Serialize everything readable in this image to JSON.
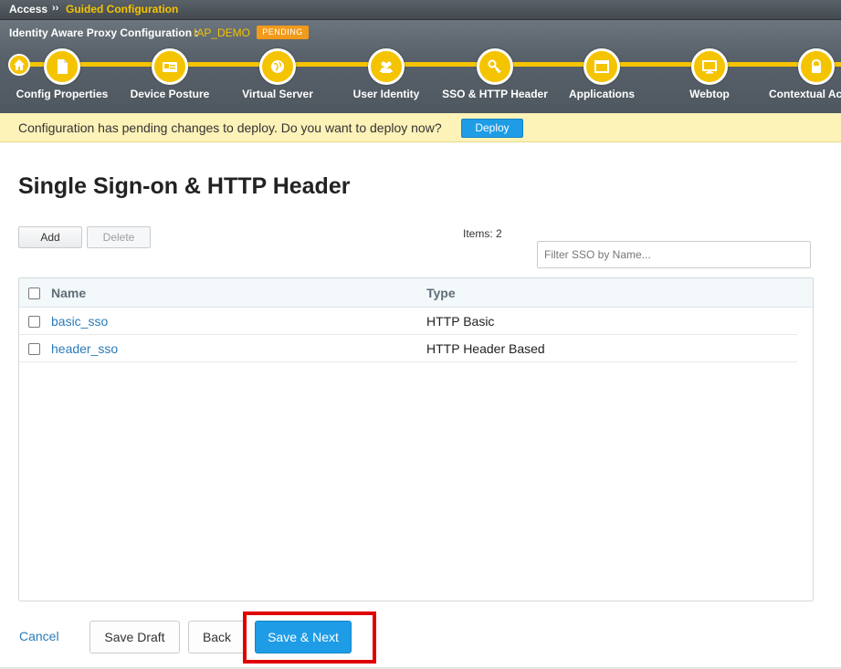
{
  "breadcrumb": {
    "root": "Access",
    "separator": "››",
    "current": "Guided Configuration"
  },
  "header": {
    "title": "Identity Aware Proxy Configuration :",
    "config_name": "IAP_DEMO",
    "status_badge": "PENDING"
  },
  "steps": [
    {
      "label": "Config Properties",
      "icon": "document-icon"
    },
    {
      "label": "Device Posture",
      "icon": "id-card-icon"
    },
    {
      "label": "Virtual Server",
      "icon": "globe-icon"
    },
    {
      "label": "User Identity",
      "icon": "users-icon"
    },
    {
      "label": "SSO & HTTP Header",
      "icon": "key-icon",
      "active": true
    },
    {
      "label": "Applications",
      "icon": "window-icon"
    },
    {
      "label": "Webtop",
      "icon": "monitor-icon"
    },
    {
      "label": "Contextual Ac",
      "icon": "lock-icon"
    }
  ],
  "banner": {
    "text": "Configuration has pending changes to deploy. Do you want to deploy now?",
    "deploy_label": "Deploy"
  },
  "main": {
    "title": "Single Sign-on & HTTP Header",
    "add_label": "Add",
    "delete_label": "Delete",
    "items_count": "Items: 2",
    "filter_placeholder": "Filter SSO by Name...",
    "columns": {
      "name": "Name",
      "type": "Type"
    },
    "rows": [
      {
        "name": "basic_sso",
        "type": "HTTP Basic"
      },
      {
        "name": "header_sso",
        "type": "HTTP Header Based"
      }
    ]
  },
  "footer": {
    "cancel_label": "Cancel",
    "save_draft_label": "Save Draft",
    "back_label": "Back",
    "save_next_label": "Save & Next"
  },
  "colors": {
    "accent": "#f5c400",
    "primary_button": "#1e9ce6",
    "highlight_box": "#e00000",
    "badge": "#f29a1a"
  }
}
